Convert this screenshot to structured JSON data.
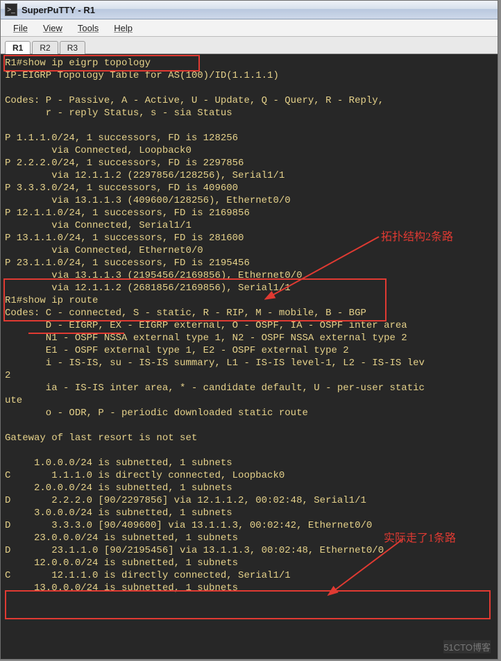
{
  "window": {
    "title": "SuperPuTTY - R1"
  },
  "menubar": {
    "items": [
      "File",
      "View",
      "Tools",
      "Help"
    ]
  },
  "tabs": {
    "items": [
      "R1",
      "R2",
      "R3"
    ],
    "active": 0
  },
  "terminal": {
    "lines": [
      "R1#show ip eigrp topology",
      "IP-EIGRP Topology Table for AS(100)/ID(1.1.1.1)",
      "",
      "Codes: P - Passive, A - Active, U - Update, Q - Query, R - Reply,",
      "       r - reply Status, s - sia Status",
      "",
      "P 1.1.1.0/24, 1 successors, FD is 128256",
      "        via Connected, Loopback0",
      "P 2.2.2.0/24, 1 successors, FD is 2297856",
      "        via 12.1.1.2 (2297856/128256), Serial1/1",
      "P 3.3.3.0/24, 1 successors, FD is 409600",
      "        via 13.1.1.3 (409600/128256), Ethernet0/0",
      "P 12.1.1.0/24, 1 successors, FD is 2169856",
      "        via Connected, Serial1/1",
      "P 13.1.1.0/24, 1 successors, FD is 281600",
      "        via Connected, Ethernet0/0",
      "P 23.1.1.0/24, 1 successors, FD is 2195456",
      "        via 13.1.1.3 (2195456/2169856), Ethernet0/0",
      "        via 12.1.1.2 (2681856/2169856), Serial1/1",
      "R1#show ip route",
      "Codes: C - connected, S - static, R - RIP, M - mobile, B - BGP",
      "       D - EIGRP, EX - EIGRP external, O - OSPF, IA - OSPF inter area",
      "       N1 - OSPF NSSA external type 1, N2 - OSPF NSSA external type 2",
      "       E1 - OSPF external type 1, E2 - OSPF external type 2",
      "       i - IS-IS, su - IS-IS summary, L1 - IS-IS level-1, L2 - IS-IS lev",
      "2",
      "       ia - IS-IS inter area, * - candidate default, U - per-user static",
      "ute",
      "       o - ODR, P - periodic downloaded static route",
      "",
      "Gateway of last resort is not set",
      "",
      "     1.0.0.0/24 is subnetted, 1 subnets",
      "C       1.1.1.0 is directly connected, Loopback0",
      "     2.0.0.0/24 is subnetted, 1 subnets",
      "D       2.2.2.0 [90/2297856] via 12.1.1.2, 00:02:48, Serial1/1",
      "     3.0.0.0/24 is subnetted, 1 subnets",
      "D       3.3.3.0 [90/409600] via 13.1.1.3, 00:02:42, Ethernet0/0",
      "     23.0.0.0/24 is subnetted, 1 subnets",
      "D       23.1.1.0 [90/2195456] via 13.1.1.3, 00:02:48, Ethernet0/0",
      "     12.0.0.0/24 is subnetted, 1 subnets",
      "C       12.1.1.0 is directly connected, Serial1/1",
      "     13.0.0.0/24 is subnetted, 1 subnets"
    ]
  },
  "annotations": {
    "note1": "拓扑结构2条路",
    "note2": "实际走了1条路"
  },
  "watermark": "51CTO博客"
}
